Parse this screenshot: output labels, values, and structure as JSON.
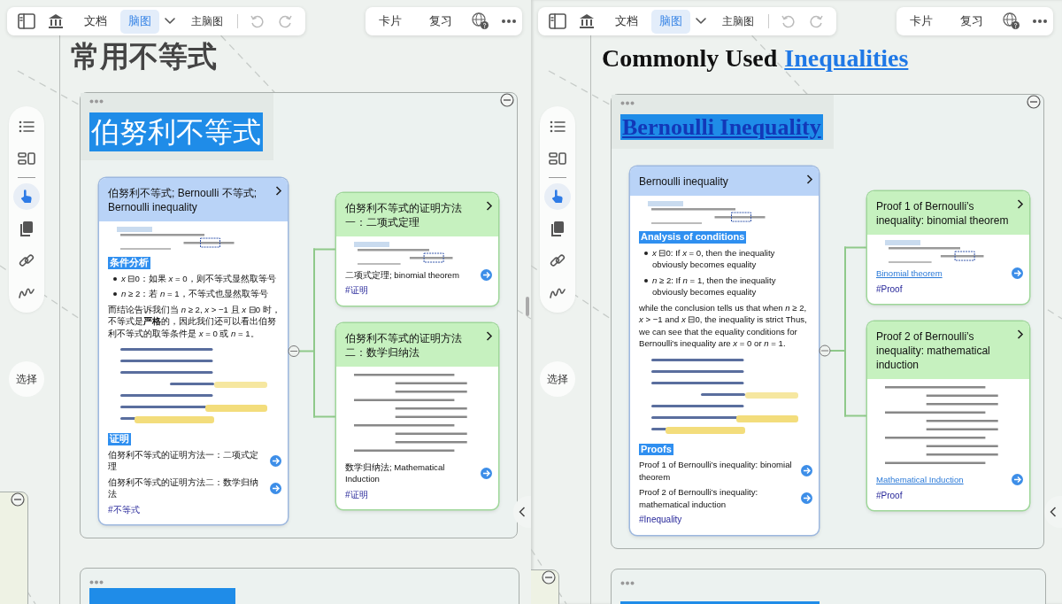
{
  "panes": [
    {
      "toolbar": {
        "tabs": [
          {
            "label": "文档",
            "selected": false
          },
          {
            "label": "脑图",
            "selected": true
          }
        ],
        "map_menu": "主脑图",
        "right_buttons": [
          "卡片",
          "复习"
        ]
      },
      "side_tools": [
        {
          "kind": "outline",
          "selected": false
        },
        {
          "kind": "layout",
          "selected": false
        },
        {
          "kind": "hand",
          "selected": true
        },
        {
          "kind": "copy",
          "selected": false
        },
        {
          "kind": "link",
          "selected": false
        },
        {
          "kind": "pen",
          "selected": false
        }
      ],
      "select_button": "选择",
      "title": {
        "kind": "plain",
        "text": "常用不等式"
      },
      "group": {
        "heading": {
          "kind": "plain",
          "text": "伯努利不等式"
        },
        "main_card": {
          "title": "伯努利不等式; Bernoulli 不等式; Bernoulli inequality",
          "blocks": [
            {
              "kind": "formula"
            },
            {
              "kind": "heading",
              "text": "条件分析"
            },
            {
              "kind": "bullet",
              "text": "*x* ⊟0：如果 *x* = 0，则不等式显然取等号"
            },
            {
              "kind": "bullet",
              "text": "*n* ≥ 2：若 *n* = 1，不等式也显然取等号"
            },
            {
              "kind": "paragraph",
              "text": "而结论告诉我们当 *n* ≥ 2, *x* > −1 且 *x* ⊟0 时，不等式是**严格**的，因此我们还可以看出伯努利不等式的取等条件是 *x* = 0 或 *n* = 1。"
            },
            {
              "kind": "sketch"
            },
            {
              "kind": "heading",
              "text": "证明"
            },
            {
              "kind": "item",
              "text": "伯努利不等式的证明方法一：二项式定理",
              "link": false
            },
            {
              "kind": "item",
              "text": "伯努利不等式的证明方法二：数学归纳法",
              "link": false
            },
            {
              "kind": "tag",
              "text": "#不等式"
            }
          ]
        },
        "child_cards": [
          {
            "title": "伯努利不等式的证明方法一：二项式定理",
            "blocks": [
              {
                "kind": "formula"
              },
              {
                "kind": "item",
                "text": "二项式定理; binomial theorem",
                "link": false
              },
              {
                "kind": "tag",
                "text": "#证明"
              }
            ]
          },
          {
            "title": "伯努利不等式的证明方法二：数学归纳法",
            "blocks": [
              {
                "kind": "derivation"
              },
              {
                "kind": "item",
                "text": "数学归纳法; Mathematical Induction",
                "link": false
              },
              {
                "kind": "tag",
                "text": "#证明"
              }
            ]
          }
        ]
      }
    },
    {
      "toolbar": {
        "tabs": [
          {
            "label": "文档",
            "selected": false
          },
          {
            "label": "脑图",
            "selected": true
          }
        ],
        "map_menu": "主脑图",
        "right_buttons": [
          "卡片",
          "复习"
        ]
      },
      "side_tools": [
        {
          "kind": "outline",
          "selected": false
        },
        {
          "kind": "layout",
          "selected": false
        },
        {
          "kind": "hand",
          "selected": true
        },
        {
          "kind": "copy",
          "selected": false
        },
        {
          "kind": "link",
          "selected": false
        },
        {
          "kind": "pen",
          "selected": false
        }
      ],
      "select_button": "选择",
      "title": {
        "kind": "rich",
        "text": "Commonly Used",
        "link": "Inequalities"
      },
      "group": {
        "heading": {
          "kind": "link",
          "text": "Bernoulli Inequality"
        },
        "main_card": {
          "title": "Bernoulli inequality",
          "blocks": [
            {
              "kind": "formula"
            },
            {
              "kind": "heading",
              "text": "Analysis of conditions"
            },
            {
              "kind": "bullet",
              "text": "*x* ⊟0: If *x* = 0, then the inequality obviously becomes equality"
            },
            {
              "kind": "bullet",
              "text": "*n* ≥ 2: If *n* = 1, then the inequality obviously becomes equality"
            },
            {
              "kind": "paragraph",
              "text": "while the conclusion tells us that when *n* ≥ 2, *x* > −1 and *x* ⊟0, the inequality is strict Thus, we can see that the equality conditions for Bernoulli's inequality are *x* = 0 or *n* = 1."
            },
            {
              "kind": "sketch"
            },
            {
              "kind": "heading",
              "text": "Proofs"
            },
            {
              "kind": "item",
              "text": "Proof 1 of Bernoulli’s inequality: binomial theorem",
              "link": false
            },
            {
              "kind": "item",
              "text": "Proof 2 of Bernoulli’s inequality: mathematical induction",
              "link": false
            },
            {
              "kind": "tag",
              "text": "#Inequality"
            }
          ]
        },
        "child_cards": [
          {
            "title": "Proof 1 of Bernoulli’s inequality: binomial theorem",
            "blocks": [
              {
                "kind": "formula"
              },
              {
                "kind": "item",
                "text": "Binomial theorem",
                "link": true
              },
              {
                "kind": "tag",
                "text": "#Proof"
              }
            ]
          },
          {
            "title": "Proof 2 of Bernoulli’s inequality: mathematical induction",
            "blocks": [
              {
                "kind": "derivation"
              },
              {
                "kind": "item",
                "text": "Mathematical Induction",
                "link": true
              },
              {
                "kind": "tag",
                "text": "#Proof"
              }
            ]
          }
        ]
      }
    }
  ]
}
